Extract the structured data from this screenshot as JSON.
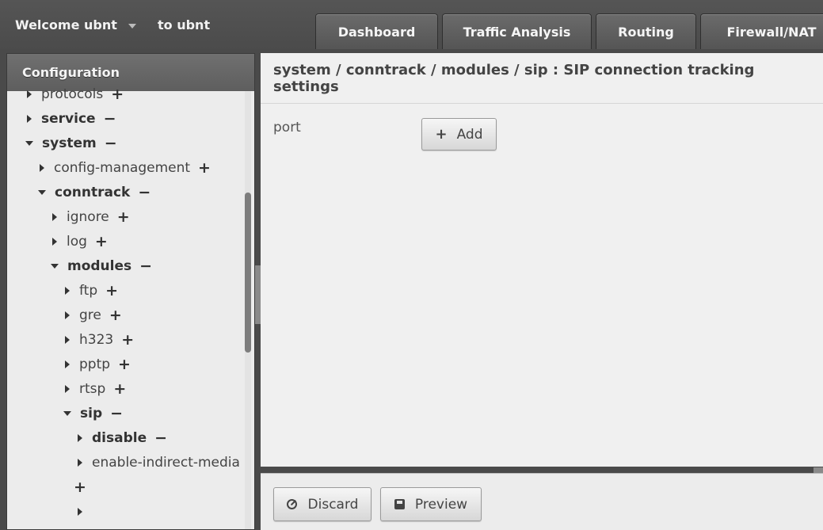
{
  "header": {
    "welcome_label": "Welcome ubnt",
    "to_user_label": "to ubnt",
    "tabs": [
      {
        "label": "Dashboard"
      },
      {
        "label": "Traffic Analysis"
      },
      {
        "label": "Routing"
      },
      {
        "label": "Firewall/NAT"
      }
    ]
  },
  "sidebar": {
    "title": "Configuration",
    "nodes": [
      {
        "label": "protocols",
        "state": "collapsed",
        "action": "+"
      },
      {
        "label": "service",
        "state": "collapsed",
        "action": "−"
      },
      {
        "label": "system",
        "state": "expanded",
        "action": "−"
      },
      {
        "label": "config-management",
        "state": "collapsed",
        "action": "+"
      },
      {
        "label": "conntrack",
        "state": "expanded",
        "action": "−"
      },
      {
        "label": "ignore",
        "state": "collapsed",
        "action": "+"
      },
      {
        "label": "log",
        "state": "collapsed",
        "action": "+"
      },
      {
        "label": "modules",
        "state": "expanded",
        "action": "−"
      },
      {
        "label": "ftp",
        "state": "collapsed",
        "action": "+"
      },
      {
        "label": "gre",
        "state": "collapsed",
        "action": "+"
      },
      {
        "label": "h323",
        "state": "collapsed",
        "action": "+"
      },
      {
        "label": "pptp",
        "state": "collapsed",
        "action": "+"
      },
      {
        "label": "rtsp",
        "state": "collapsed",
        "action": "+"
      },
      {
        "label": "sip",
        "state": "expanded",
        "action": "−"
      },
      {
        "label": "disable",
        "state": "collapsed",
        "action": "−"
      },
      {
        "label": "enable-indirect-media",
        "state": "collapsed",
        "action": "+"
      }
    ]
  },
  "main": {
    "breadcrumb_title": "system / conntrack / modules / sip : SIP connection tracking settings",
    "port_label": "port",
    "add_label": "Add",
    "add_icon": "plus-icon"
  },
  "footer": {
    "discard_label": "Discard",
    "discard_icon": "cancel-icon",
    "preview_label": "Preview",
    "preview_icon": "save-icon"
  }
}
